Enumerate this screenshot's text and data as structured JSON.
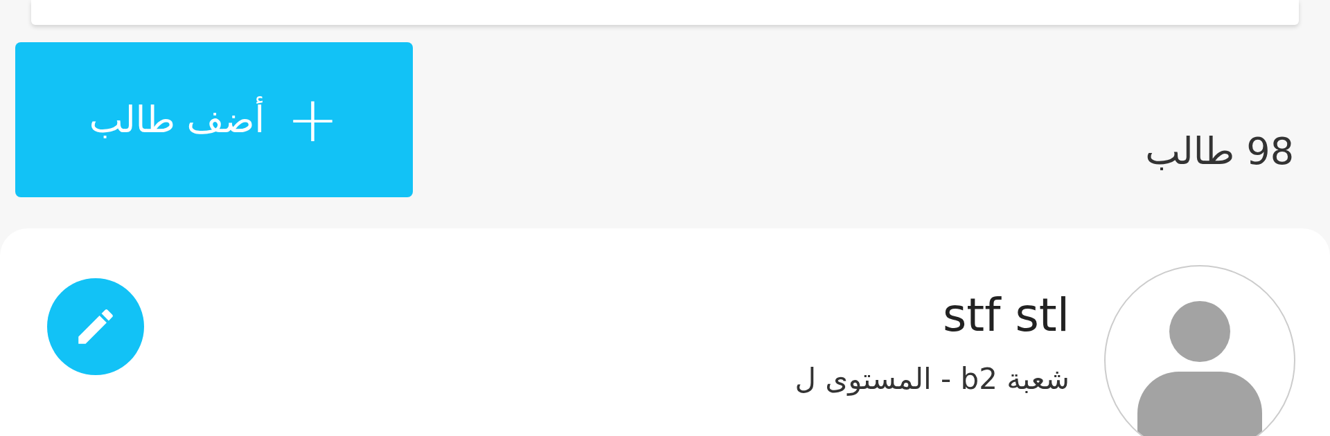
{
  "add_button": {
    "icon": "+",
    "label": "أضف طالب"
  },
  "student_count": "98 طالب",
  "students": [
    {
      "name": "stf stl",
      "subtitle": "شعبة b2 - المستوى ل"
    }
  ]
}
